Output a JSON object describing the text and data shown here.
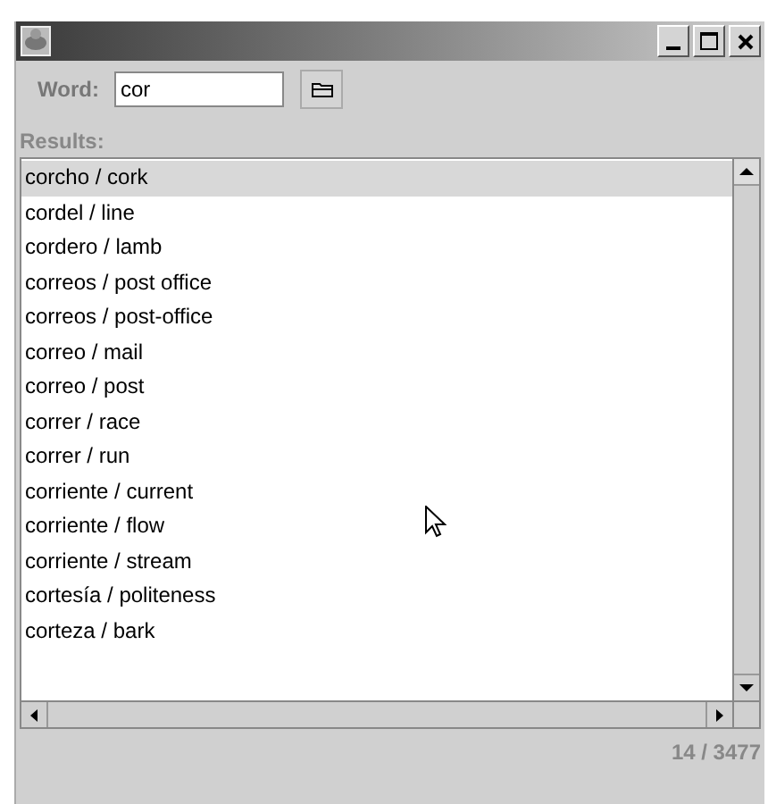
{
  "search": {
    "label": "Word:",
    "value": "cor"
  },
  "results": {
    "label": "Results:",
    "items": [
      {
        "text": "corcho / cork",
        "selected": true
      },
      {
        "text": "cordel / line",
        "selected": false
      },
      {
        "text": "cordero / lamb",
        "selected": false
      },
      {
        "text": "correos / post office",
        "selected": false
      },
      {
        "text": "correos / post-office",
        "selected": false
      },
      {
        "text": "correo / mail",
        "selected": false
      },
      {
        "text": "correo / post",
        "selected": false
      },
      {
        "text": "correr / race",
        "selected": false
      },
      {
        "text": "correr / run",
        "selected": false
      },
      {
        "text": "corriente / current",
        "selected": false
      },
      {
        "text": "corriente / flow",
        "selected": false
      },
      {
        "text": "corriente / stream",
        "selected": false
      },
      {
        "text": "cortesía / politeness",
        "selected": false
      },
      {
        "text": "corteza / bark",
        "selected": false
      }
    ]
  },
  "status_bar": {
    "count": "14 / 3477"
  }
}
